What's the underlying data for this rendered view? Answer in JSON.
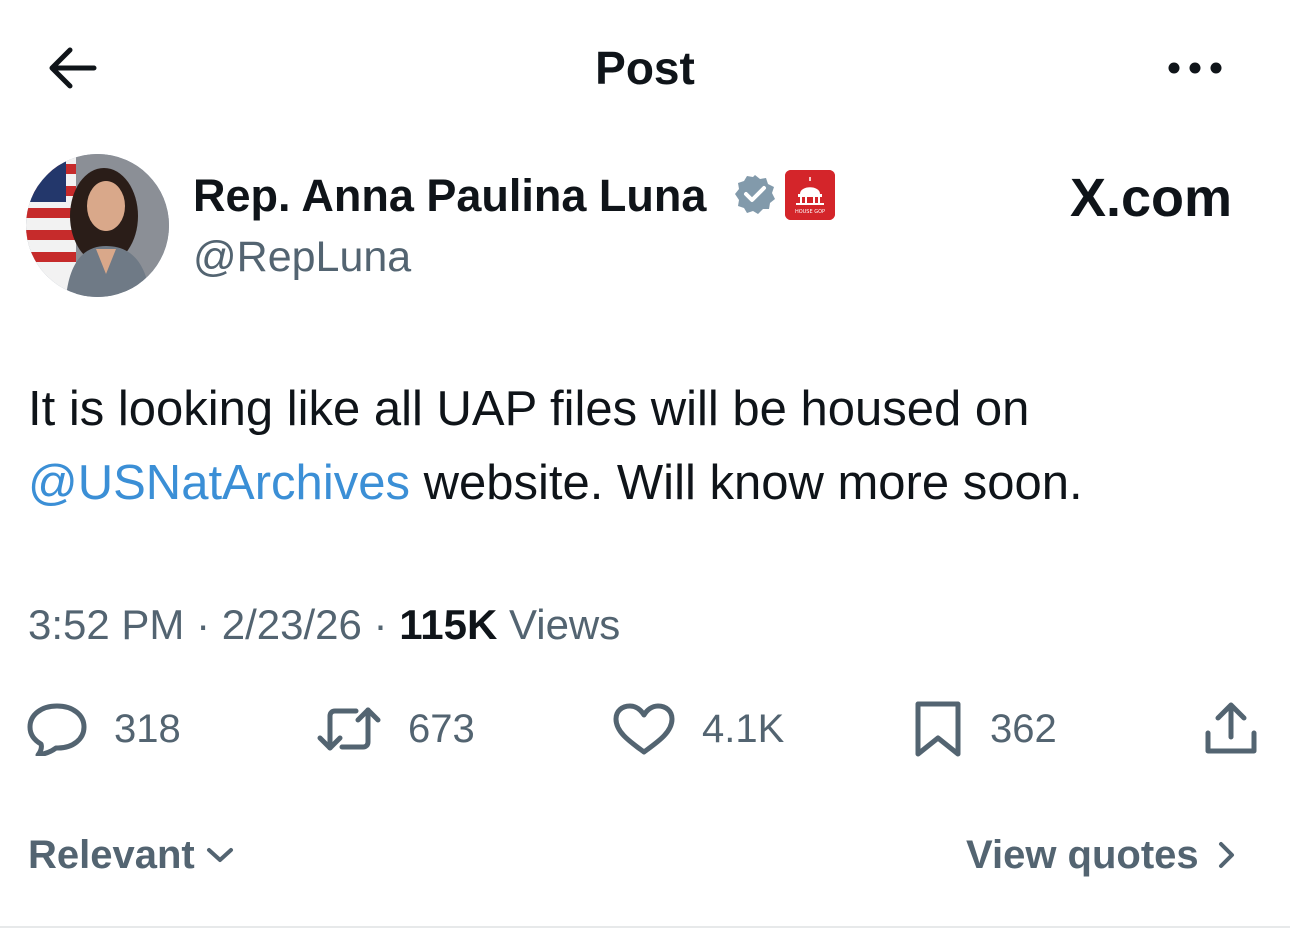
{
  "header": {
    "title": "Post",
    "back_icon": "arrow-left-icon",
    "more_icon": "more-horizontal-icon"
  },
  "author": {
    "name": "Rep. Anna Paulina Luna",
    "handle": "@RepLuna",
    "verified_badge": "verified-badge-icon",
    "verified_color": "#829aab",
    "affiliation_badge": "house-gop-badge",
    "affiliation_text": "HOUSE GOP",
    "affiliation_color": "#d4252a"
  },
  "watermark": "X.com",
  "tweet": {
    "text_line1": "It is looking like all UAP files will be housed on",
    "mention": "@USNatArchives",
    "text_line2_rest": " website. Will know more soon.",
    "mention_color": "#3b8fd6"
  },
  "meta": {
    "time": "3:52 PM",
    "separator": " · ",
    "date": "2/23/26",
    "views_count": "115K",
    "views_label": " Views"
  },
  "actions": {
    "replies": "318",
    "reposts": "673",
    "likes": "4.1K",
    "bookmarks": "362",
    "icons": [
      "reply-icon",
      "repost-icon",
      "like-icon",
      "bookmark-icon",
      "share-icon"
    ]
  },
  "footer": {
    "sort_label": "Relevant",
    "view_quotes_label": "View quotes"
  }
}
